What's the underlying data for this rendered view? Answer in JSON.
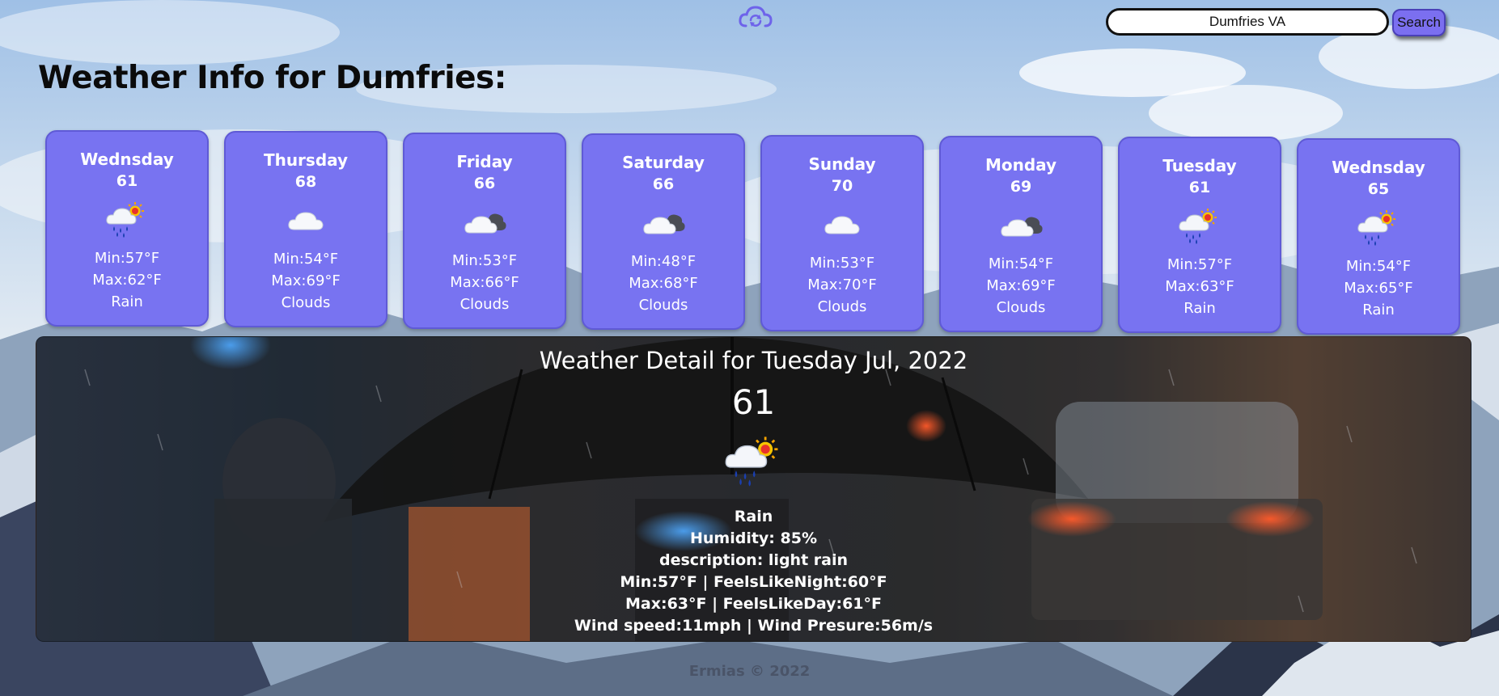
{
  "colors": {
    "accent": "#7873f1",
    "card_border": "#5f5ad6",
    "title": "#0b0b0b",
    "detail_text": "#ffffff",
    "footer": "#4a5468"
  },
  "header": {
    "logo_icon": "cloud-sync-icon"
  },
  "search": {
    "value": "Dumfries VA",
    "button_label": "Search"
  },
  "page": {
    "title": "Weather Info for Dumfries:"
  },
  "forecast": [
    {
      "day": "Wednsday",
      "temp": "61",
      "min": "Min:57°F",
      "max": "Max:62°F",
      "condition": "Rain",
      "icon": "rain-sun-icon"
    },
    {
      "day": "Thursday",
      "temp": "68",
      "min": "Min:54°F",
      "max": "Max:69°F",
      "condition": "Clouds",
      "icon": "cloud-icon"
    },
    {
      "day": "Friday",
      "temp": "66",
      "min": "Min:53°F",
      "max": "Max:66°F",
      "condition": "Clouds",
      "icon": "broken-clouds-icon"
    },
    {
      "day": "Saturday",
      "temp": "66",
      "min": "Min:48°F",
      "max": "Max:68°F",
      "condition": "Clouds",
      "icon": "broken-clouds-icon"
    },
    {
      "day": "Sunday",
      "temp": "70",
      "min": "Min:53°F",
      "max": "Max:70°F",
      "condition": "Clouds",
      "icon": "cloud-icon"
    },
    {
      "day": "Monday",
      "temp": "69",
      "min": "Min:54°F",
      "max": "Max:69°F",
      "condition": "Clouds",
      "icon": "broken-clouds-icon"
    },
    {
      "day": "Tuesday",
      "temp": "61",
      "min": "Min:57°F",
      "max": "Max:63°F",
      "condition": "Rain",
      "icon": "rain-sun-icon"
    },
    {
      "day": "Wednsday",
      "temp": "65",
      "min": "Min:54°F",
      "max": "Max:65°F",
      "condition": "Rain",
      "icon": "rain-sun-icon"
    }
  ],
  "detail": {
    "title": "Weather Detail for Tuesday Jul, 2022",
    "temp": "61",
    "icon": "rain-sun-icon",
    "condition": "Rain",
    "humidity": "Humidity: 85%",
    "description": "description: light rain",
    "min_line": "Min:57°F | FeelsLikeNight:60°F",
    "max_line": "Max:63°F | FeelsLikeDay:61°F",
    "wind_line": "Wind speed:11mph | Wind Presure:56m/s"
  },
  "footer": {
    "text": "Ermias © 2022"
  }
}
